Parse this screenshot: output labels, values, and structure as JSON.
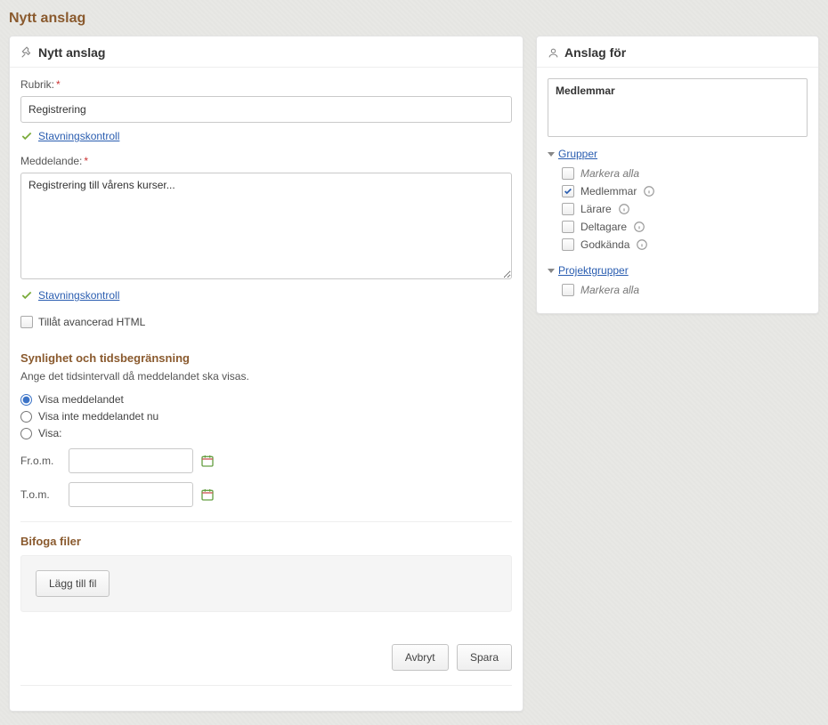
{
  "page_title": "Nytt anslag",
  "left_panel": {
    "header": "Nytt anslag",
    "rubrik_label": "Rubrik:",
    "rubrik_value": "Registrering",
    "spellcheck_label": "Stavningskontroll",
    "meddelande_label": "Meddelande:",
    "meddelande_value": "Registrering till vårens kurser...",
    "allow_html_label": "Tillåt avancerad HTML",
    "visibility_heading": "Synlighet och tidsbegränsning",
    "visibility_help": "Ange det tidsintervall då meddelandet ska visas.",
    "radio_show": "Visa meddelandet",
    "radio_hide": "Visa inte meddelandet nu",
    "radio_range": "Visa:",
    "from_label": "Fr.o.m.",
    "to_label": "T.o.m.",
    "attach_heading": "Bifoga filer",
    "add_file_label": "Lägg till fil",
    "cancel_label": "Avbryt",
    "save_label": "Spara"
  },
  "right_panel": {
    "header": "Anslag för",
    "selected_text": "Medlemmar",
    "groups_label": "Grupper",
    "select_all_label": "Markera alla",
    "members_label": "Medlemmar",
    "teachers_label": "Lärare",
    "participants_label": "Deltagare",
    "approved_label": "Godkända",
    "project_groups_label": "Projektgrupper"
  }
}
